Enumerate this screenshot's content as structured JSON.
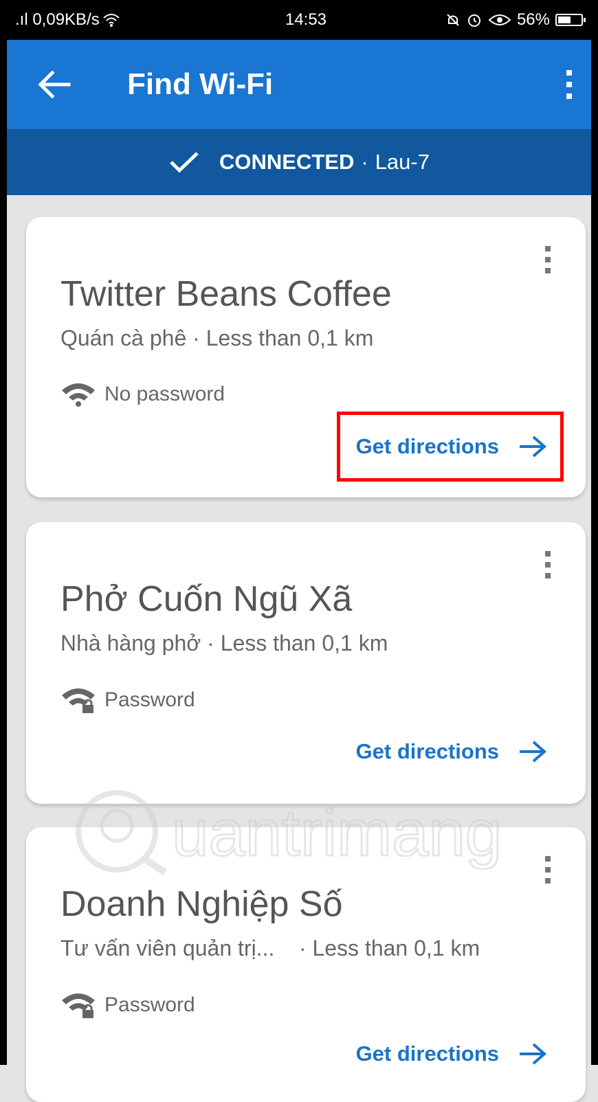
{
  "status_bar": {
    "network_speed": ".ıl 0,09KB/s",
    "time": "14:53",
    "battery": "56%",
    "battery_level": 0.56
  },
  "app_bar": {
    "title": "Find Wi-Fi",
    "back_icon": "arrow-back-icon",
    "menu_icon": "more-vert-icon"
  },
  "connection": {
    "status": "CONNECTED",
    "separator": "·",
    "network": "Lau-7"
  },
  "cards": [
    {
      "name": "Twitter Beans Coffee",
      "subtitle": "Quán cà phê · Less than 0,1 km",
      "wifi_label": "No password",
      "wifi_icon": "wifi-icon",
      "directions_label": "Get directions"
    },
    {
      "name": "Phở Cuốn Ngũ Xã",
      "subtitle": "Nhà hàng phở · Less than 0,1 km",
      "wifi_label": "Password",
      "wifi_icon": "wifi-lock-icon",
      "directions_label": "Get directions"
    },
    {
      "name": "Doanh Nghiệp Số",
      "subtitle": "Tư vấn viên quản trị...    · Less than 0,1 km",
      "wifi_label": "Password",
      "wifi_icon": "wifi-lock-icon",
      "directions_label": "Get directions"
    }
  ],
  "watermark": "Quantrimang",
  "colors": {
    "app_bar": "#1976d2",
    "connection_bar": "#11589e",
    "link": "#1a73c8",
    "highlight": "#ff0000"
  }
}
